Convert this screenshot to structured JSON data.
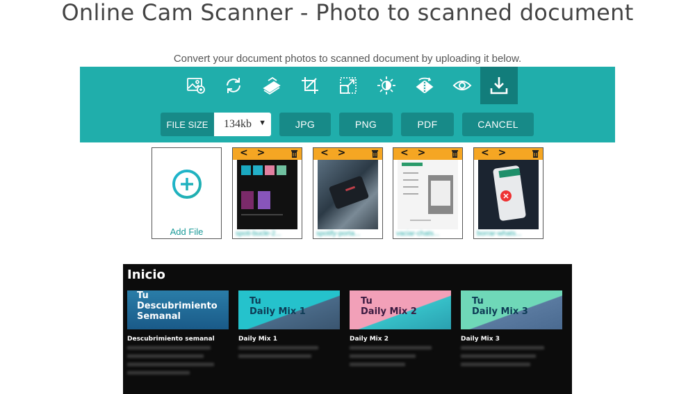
{
  "header": {
    "title": "Online Cam Scanner - Photo to scanned document",
    "subtitle": "Convert your document photos to scanned document by uploading it below."
  },
  "toolbar": {
    "tools": [
      {
        "name": "image-icon"
      },
      {
        "name": "rotate-icon"
      },
      {
        "name": "scanner-icon"
      },
      {
        "name": "crop-icon"
      },
      {
        "name": "resize-icon"
      },
      {
        "name": "brightness-icon"
      },
      {
        "name": "flip-icon"
      },
      {
        "name": "eye-icon"
      },
      {
        "name": "download-icon",
        "active": true
      }
    ],
    "file_size_label": "FILE SIZE",
    "file_size_value": "134kb",
    "buttons": {
      "jpg": "JPG",
      "png": "PNG",
      "pdf": "PDF",
      "cancel": "CANCEL"
    }
  },
  "uploads": {
    "add_label": "Add File",
    "arrows": "< >",
    "files": [
      {
        "name": "spoti-bucle-2..."
      },
      {
        "name": "spotify-porta..."
      },
      {
        "name": "vaciar-chats..."
      },
      {
        "name": "borrar-whats..."
      }
    ]
  },
  "preview": {
    "title": "Inicio",
    "cards": [
      {
        "line1": "Tu",
        "line2": "Descubrimiento",
        "line3": "Semanal",
        "caption": "Descubrimiento semanal"
      },
      {
        "line1": "Tu",
        "line2": "Daily Mix 1",
        "line3": "",
        "caption": "Daily Mix 1"
      },
      {
        "line1": "Tu",
        "line2": "Daily Mix 2",
        "line3": "",
        "caption": "Daily Mix 2"
      },
      {
        "line1": "Tu",
        "line2": "Daily Mix 3",
        "line3": "",
        "caption": "Daily Mix 3"
      }
    ]
  },
  "colors": {
    "accent": "#20aeab",
    "button": "#178a88",
    "active_tool": "#127d7b",
    "thumb_bar": "#f5a623"
  }
}
